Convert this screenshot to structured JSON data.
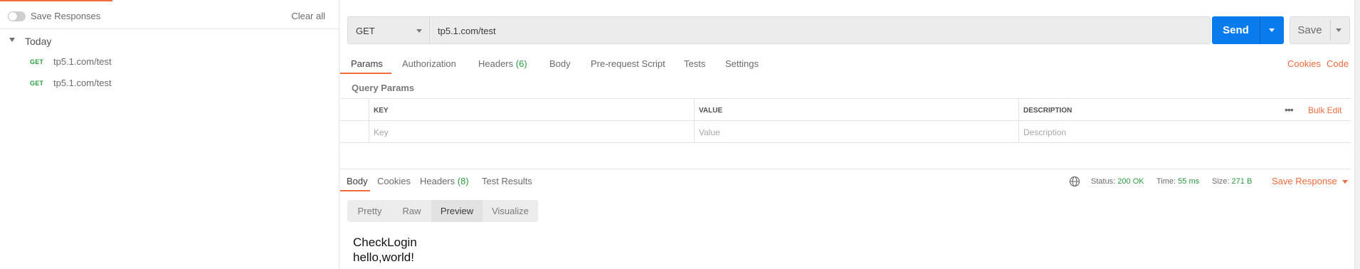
{
  "sidebar": {
    "save_responses_label": "Save Responses",
    "clear_all": "Clear all",
    "group_label": "Today",
    "items": [
      {
        "method": "GET",
        "url": "tp5.1.com/test"
      },
      {
        "method": "GET",
        "url": "tp5.1.com/test"
      }
    ]
  },
  "request": {
    "method": "GET",
    "url": "tp5.1.com/test",
    "send_label": "Send",
    "save_label": "Save",
    "tabs": [
      {
        "label": "Params"
      },
      {
        "label": "Authorization"
      },
      {
        "label": "Headers",
        "count": "(6)"
      },
      {
        "label": "Body"
      },
      {
        "label": "Pre-request Script"
      },
      {
        "label": "Tests"
      },
      {
        "label": "Settings"
      }
    ],
    "cookies_link": "Cookies",
    "code_link": "Code",
    "query_params_title": "Query Params",
    "table": {
      "headers": [
        "KEY",
        "VALUE",
        "DESCRIPTION"
      ],
      "placeholders": [
        "Key",
        "Value",
        "Description"
      ],
      "bulk_edit": "Bulk Edit",
      "more": "•••"
    }
  },
  "response": {
    "tabs": [
      {
        "label": "Body"
      },
      {
        "label": "Cookies"
      },
      {
        "label": "Headers",
        "count": "(8)"
      },
      {
        "label": "Test Results"
      }
    ],
    "status_label": "Status:",
    "status_value": "200 OK",
    "time_label": "Time:",
    "time_value": "55 ms",
    "size_label": "Size:",
    "size_value": "271 B",
    "save_response": "Save Response",
    "view_tabs": [
      "Pretty",
      "Raw",
      "Preview",
      "Visualize"
    ],
    "body_lines": [
      "CheckLogin",
      "hello,world!"
    ]
  },
  "colors": {
    "accent": "#f26b3a",
    "send": "#097bed",
    "ok": "#2a9d3f"
  }
}
